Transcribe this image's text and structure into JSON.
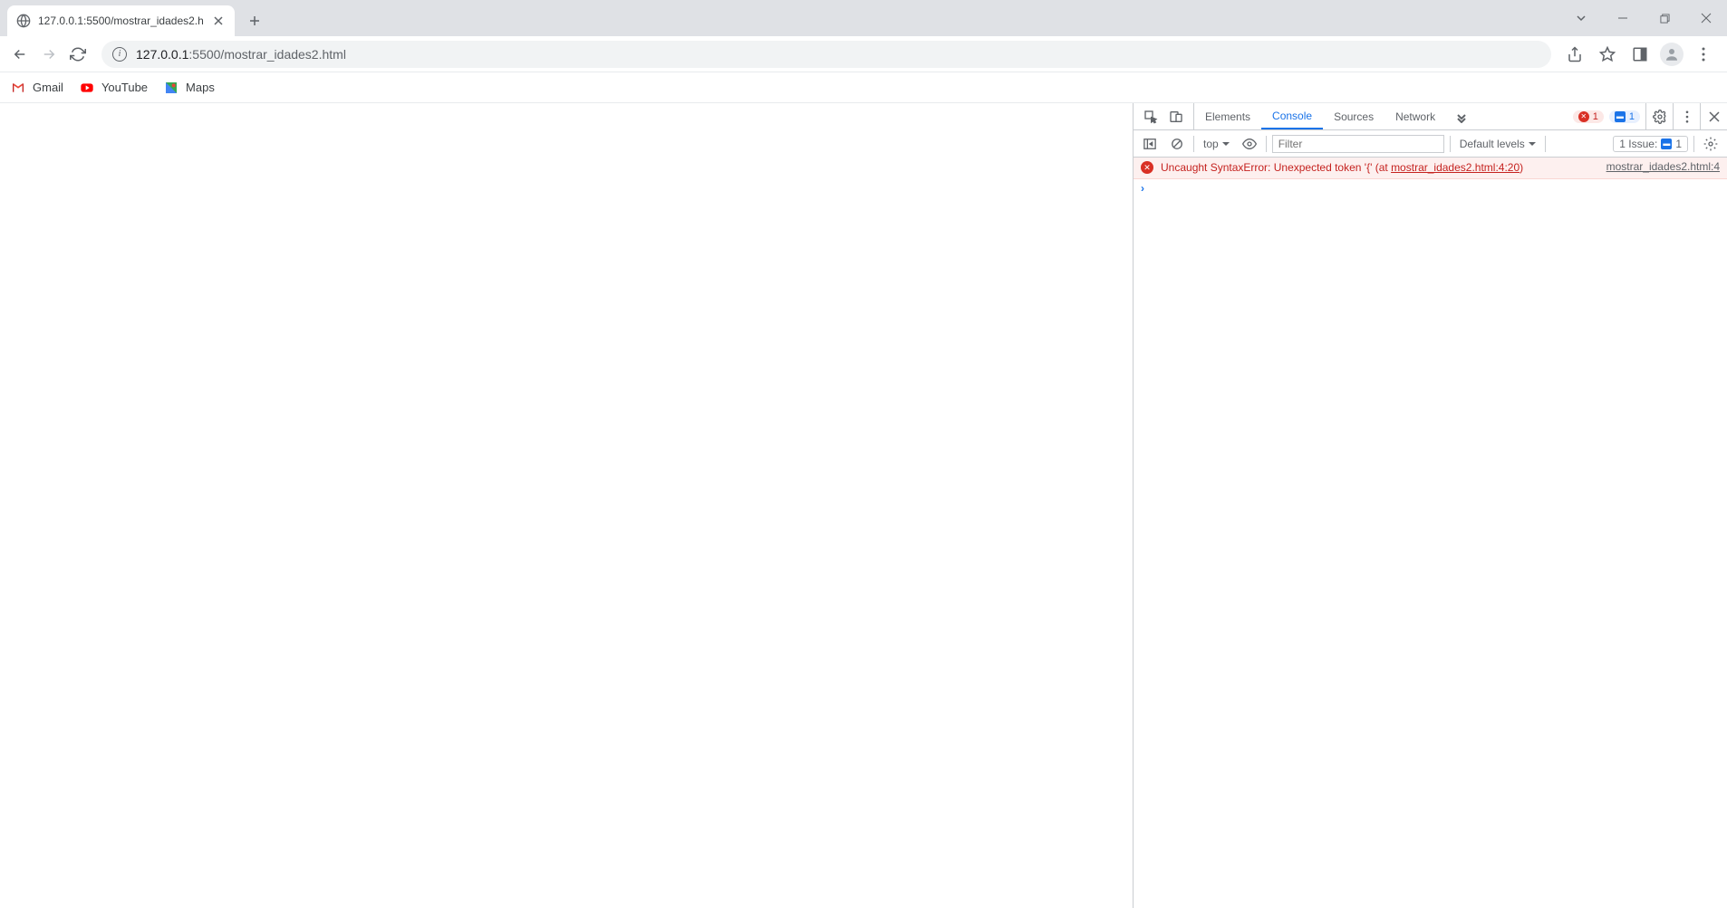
{
  "tab": {
    "title": "127.0.0.1:5500/mostrar_idades2.h"
  },
  "omnibox": {
    "host": "127.0.0.1",
    "path": ":5500/mostrar_idades2.html"
  },
  "bookmarks": [
    {
      "label": "Gmail"
    },
    {
      "label": "YouTube"
    },
    {
      "label": "Maps"
    }
  ],
  "devtools": {
    "tabs": {
      "elements": "Elements",
      "console": "Console",
      "sources": "Sources",
      "network": "Network"
    },
    "error_badge_count": "1",
    "msg_badge_count": "1",
    "console_toolbar": {
      "context": "top",
      "filter_placeholder": "Filter",
      "levels": "Default levels",
      "issues_label": "1 Issue:",
      "issues_count": "1"
    },
    "console_error": {
      "message_prefix": "Uncaught SyntaxError: Unexpected token '{' (at ",
      "link_text": "mostrar_idades2.html:4:20",
      "message_suffix": ")",
      "source": "mostrar_idades2.html:4"
    }
  }
}
